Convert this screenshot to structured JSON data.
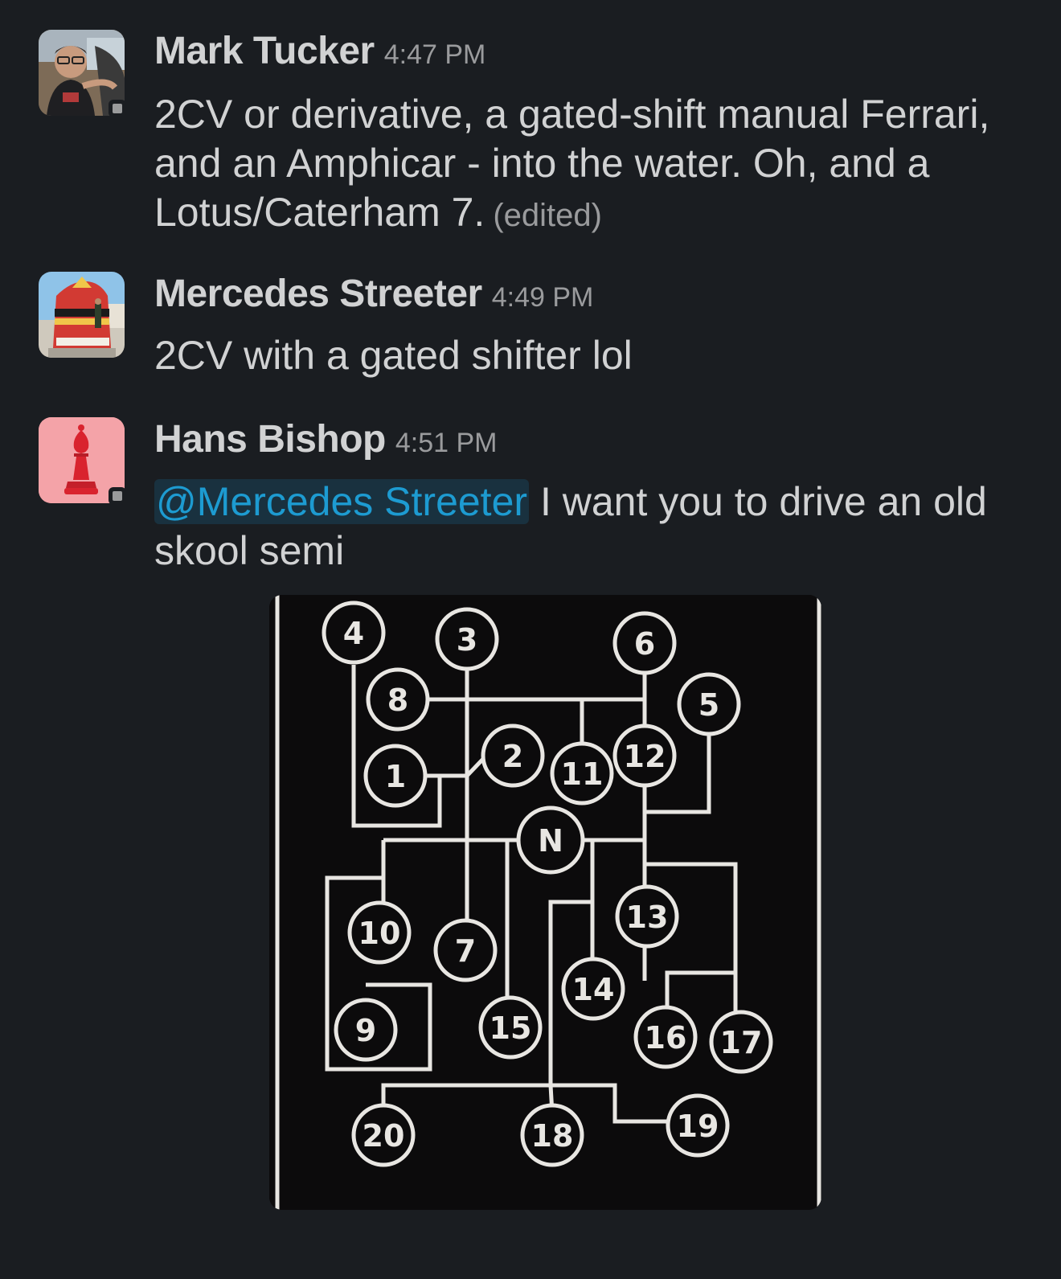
{
  "messages": [
    {
      "author": "Mark Tucker",
      "time": "4:47 PM",
      "text": "2CV or derivative, a gated-shift manual Ferrari, and an Amphicar - into the water. Oh, and a Lotus/Caterham 7.",
      "edited_label": "(edited)",
      "avatar": "person-in-car-photo"
    },
    {
      "author": "Mercedes Streeter",
      "time": "4:49 PM",
      "text": "2CV with a gated shifter lol",
      "avatar": "southernmost-point-buoy-photo"
    },
    {
      "author": "Hans Bishop",
      "time": "4:51 PM",
      "mention": "@Mercedes Streeter",
      "text": " I want you to drive an old skool semi",
      "avatar": "red-bishop-chess-piece",
      "attachment": {
        "type": "image",
        "subject": "shift-pattern-diagram",
        "gears": [
          "4",
          "3",
          "6",
          "8",
          "5",
          "2",
          "11",
          "12",
          "1",
          "N",
          "10",
          "13",
          "7",
          "14",
          "9",
          "15",
          "16",
          "17",
          "20",
          "18",
          "19"
        ]
      }
    }
  ],
  "colors": {
    "background": "#1a1d21",
    "text": "#d1d2d3",
    "muted": "#9a9b9d",
    "mention": "#1d9bd1",
    "mention_bg": "#19313f",
    "avatar_pink": "#f4a3a8",
    "bishop_red": "#d9232e"
  }
}
